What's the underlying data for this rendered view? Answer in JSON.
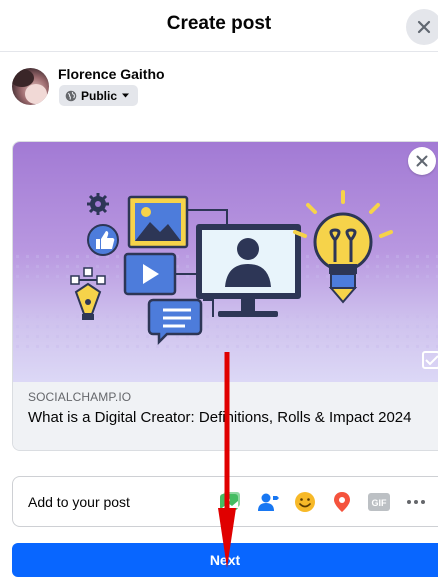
{
  "dialog": {
    "title": "Create post"
  },
  "author": {
    "name": "Florence Gaitho",
    "privacy_label": "Public"
  },
  "link_preview": {
    "domain": "SOCIALCHAMP.IO",
    "title": "What is a Digital Creator: Definitions, Rolls & Impact 2024"
  },
  "add_to_post": {
    "label": "Add to your post",
    "icons": [
      "photo-video-icon",
      "tag-people-icon",
      "feeling-icon",
      "check-in-icon",
      "gif-icon",
      "more-icon"
    ],
    "gif_text": "GIF"
  },
  "next_button": {
    "label": "Next"
  },
  "colors": {
    "primary_blue": "#0866ff",
    "annotation_red": "#e00000",
    "preview_purple_top": "#a77ad6",
    "preview_purple_bottom": "#d4c9f0"
  }
}
